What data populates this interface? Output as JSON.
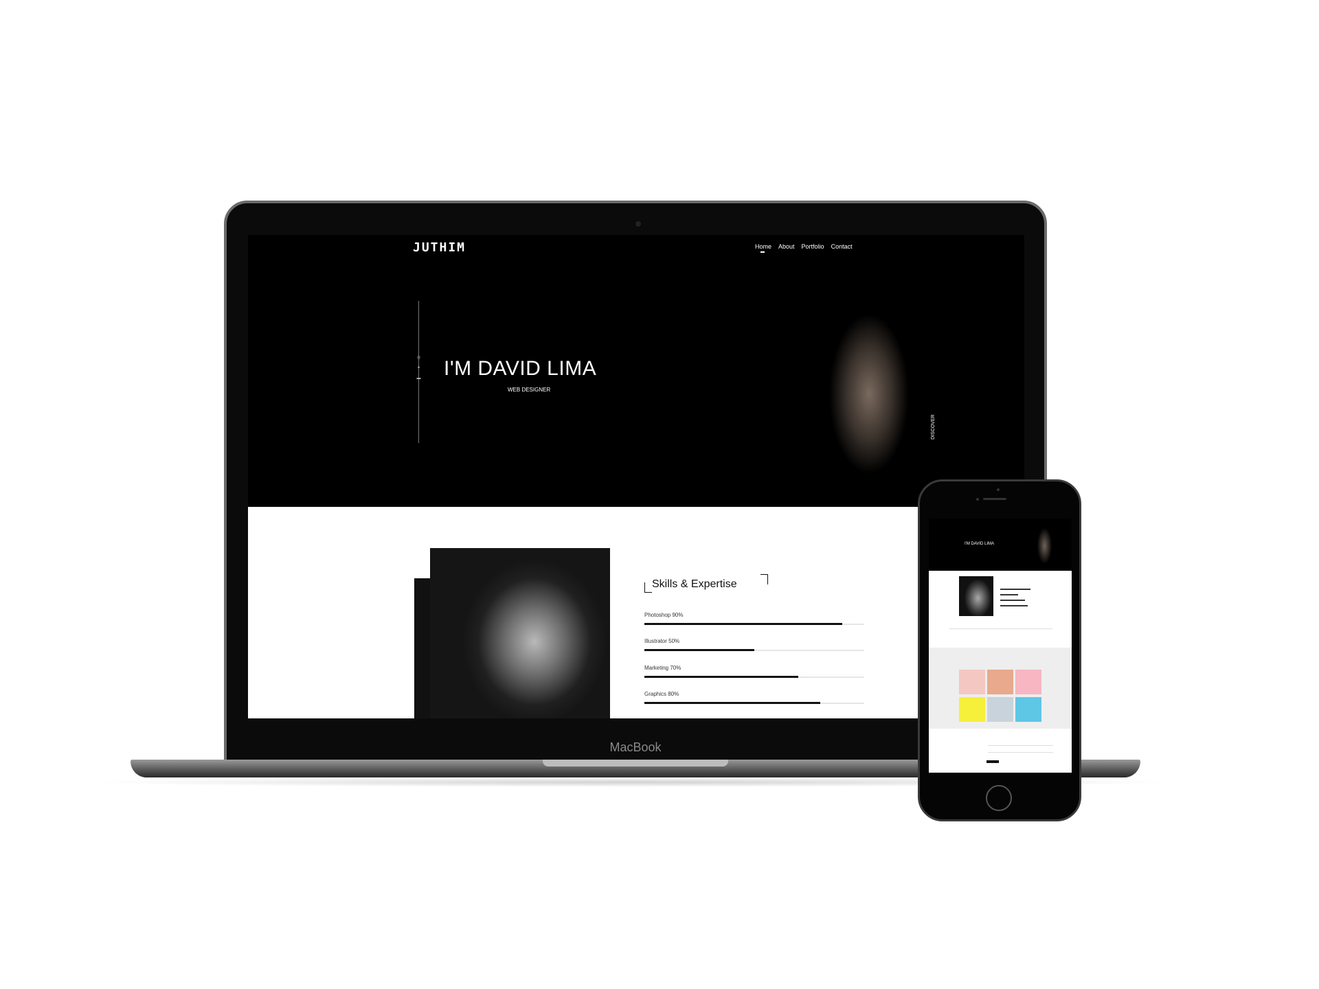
{
  "laptop": {
    "brand": "MacBook",
    "site": {
      "logo": "JUTHIM",
      "nav": [
        "Home",
        "About",
        "Portfolio",
        "Contact"
      ],
      "active_nav": "Home",
      "hero_title": "I'M DAVID LIMA",
      "hero_subtitle": "WEB DESIGNER",
      "discover": "DISCOVER",
      "skills_title": "Skills & Expertise",
      "skills": [
        {
          "label": "Photoshop 90%",
          "level": 0.9
        },
        {
          "label": "Illustrator 50%",
          "level": 0.5
        },
        {
          "label": "Marketing 70%",
          "level": 0.7
        },
        {
          "label": "Graphics 80%",
          "level": 0.8
        }
      ]
    }
  },
  "phone": {
    "site": {
      "hero_title": "I'M DAVID LIMA",
      "tile_colors": [
        "#f4c7c3",
        "#e8a98c",
        "#f7b6c2",
        "#f6f03a",
        "#c9d3dc",
        "#5fc7e6"
      ]
    }
  }
}
